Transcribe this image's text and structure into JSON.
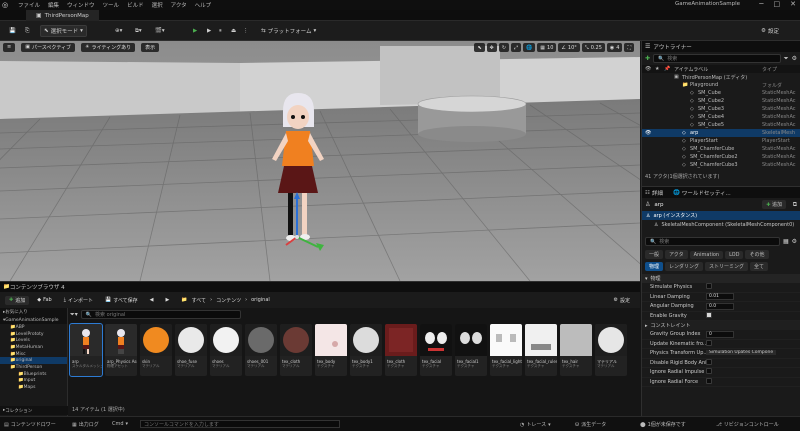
{
  "menubar": {
    "items": [
      "ファイル",
      "編集",
      "ウィンドウ",
      "ツール",
      "ビルド",
      "選択",
      "アクタ",
      "ヘルプ"
    ],
    "app_name": "GameAnimationSample"
  },
  "tab": {
    "label": "ThirdPersonMap"
  },
  "toolbar": {
    "mode": "選択モード",
    "platforms": "プラットフォーム",
    "settings": "設定"
  },
  "viewport": {
    "perspective": "パースペクティブ",
    "lit": "ライティングあり",
    "show": "表示",
    "grid_snap": "10",
    "angle_snap": "10°",
    "scale_snap": "0.25",
    "cam_speed": "4"
  },
  "outliner": {
    "title": "アウトライナー",
    "search_placeholder": "検索",
    "col_label": "アイテムラベル",
    "col_type": "タイプ",
    "rows": [
      {
        "label": "ThirdPersonMap (エディタ)",
        "type": "",
        "indent": 14
      },
      {
        "label": "Playground",
        "type": "フォルダ",
        "indent": 22
      },
      {
        "label": "SM_Cube",
        "type": "StaticMeshAc",
        "indent": 30
      },
      {
        "label": "SM_Cube2",
        "type": "StaticMeshAc",
        "indent": 30
      },
      {
        "label": "SM_Cube3",
        "type": "StaticMeshAc",
        "indent": 30
      },
      {
        "label": "SM_Cube4",
        "type": "StaticMeshAc",
        "indent": 30
      },
      {
        "label": "SM_Cube5",
        "type": "StaticMeshAc",
        "indent": 30
      },
      {
        "label": "arp",
        "type": "SkeletalMesh",
        "indent": 22,
        "selected": true
      },
      {
        "label": "PlayerStart",
        "type": "PlayerStart",
        "indent": 22
      },
      {
        "label": "SM_ChamferCube",
        "type": "StaticMeshAc",
        "indent": 22
      },
      {
        "label": "SM_ChamferCube2",
        "type": "StaticMeshAc",
        "indent": 22
      },
      {
        "label": "SM_ChamferCube3",
        "type": "StaticMeshAc",
        "indent": 22
      }
    ],
    "footer": "41 アクタ(1個選択されています)"
  },
  "details": {
    "tab1": "詳細",
    "tab2": "ワールドセッティ...",
    "actor_name": "arp",
    "add": "追加",
    "instance": "arp (インスタンス)",
    "component": "SkeletalMeshComponent (SkeletalMeshComponent0)",
    "search_placeholder": "検索",
    "filters1": [
      "一般",
      "アクタ",
      "Animation",
      "LOD",
      "その他"
    ],
    "filters2": [
      "物理",
      "レンダリング",
      "ストリーミング",
      "全て"
    ],
    "section": "物理",
    "subsection": "コンストレイント",
    "props": [
      {
        "label": "Simulate Physics",
        "kind": "check",
        "on": false
      },
      {
        "label": "Linear Damping",
        "kind": "num",
        "value": "0.01"
      },
      {
        "label": "Angular Damping",
        "kind": "num",
        "value": "0.0"
      },
      {
        "label": "Enable Gravity",
        "kind": "check",
        "on": true
      },
      {
        "label": "",
        "kind": "section"
      },
      {
        "label": "Gravity Group Index",
        "kind": "num",
        "value": "0"
      },
      {
        "label": "Update Kinematic fro...",
        "kind": "check",
        "on": false
      },
      {
        "label": "Physics Transform Up...",
        "kind": "select",
        "value": "Simulation Upates Compone"
      },
      {
        "label": "Disable Rigid Body Ani...",
        "kind": "check",
        "on": false
      },
      {
        "label": "Ignore Radial Impulse",
        "kind": "check",
        "on": false
      },
      {
        "label": "Ignore Radial Force",
        "kind": "check",
        "on": false
      }
    ]
  },
  "content": {
    "tab": "コンテンツブラウザ 4",
    "add": "追加",
    "fab": "Fab",
    "import": "インポート",
    "save_all": "すべて保存",
    "path": [
      "すべて",
      "コンテンツ",
      "original"
    ],
    "settings": "設定",
    "search_placeholder": "検索 original",
    "favorites": "お気に入り",
    "project": "GameAnimationSample",
    "collections": "コレクション",
    "count": "14 アイテム (1 選択中)",
    "tree": [
      "ABP",
      "LevelPrototy",
      "Levels",
      "MetaHuman",
      "Misc",
      "original",
      "ThirdPerson",
      "Blueprints",
      "Input",
      "Maps"
    ],
    "assets": [
      {
        "name": "arp",
        "type": "スケルタルメッシュ",
        "thumb": "char"
      },
      {
        "name": "arp_Physics Asset",
        "type": "物理アセット",
        "thumb": "char2"
      },
      {
        "name": "skin",
        "type": "マテリアル",
        "thumb": "orange"
      },
      {
        "name": "shoe_fuse",
        "type": "マテリアル",
        "thumb": "white"
      },
      {
        "name": "shoes",
        "type": "マテリアル",
        "thumb": "white2"
      },
      {
        "name": "shoes_001",
        "type": "マテリアル",
        "thumb": "grey"
      },
      {
        "name": "tex_cloth",
        "type": "マテリアル",
        "thumb": "brown"
      },
      {
        "name": "tex_body",
        "type": "テクスチャ",
        "thumb": "tex1"
      },
      {
        "name": "tex_body1",
        "type": "テクスチャ",
        "thumb": "whitesph"
      },
      {
        "name": "tex_cloth",
        "type": "テクスチャ",
        "thumb": "redtex"
      },
      {
        "name": "tex_facial",
        "type": "テクスチャ",
        "thumb": "face1"
      },
      {
        "name": "tex_facial1",
        "type": "テクスチャ",
        "thumb": "face2"
      },
      {
        "name": "tex_facial_light",
        "type": "テクスチャ",
        "thumb": "face3"
      },
      {
        "name": "tex_facial_ruler",
        "type": "テクスチャ",
        "thumb": "face4"
      },
      {
        "name": "tex_hair",
        "type": "テクスチャ",
        "thumb": "grey2"
      },
      {
        "name": "マテリアル",
        "type": "マテリアル",
        "thumb": "mat"
      }
    ]
  },
  "status": {
    "drawer": "コンテンツドロワー",
    "output": "出力ログ",
    "cmd": "Cmd",
    "console_placeholder": "コンソールコマンドを入力します",
    "trace": "トレース",
    "derived": "派生データ",
    "unsaved": "1個が未保存です",
    "revision": "リビジョンコントロール"
  }
}
